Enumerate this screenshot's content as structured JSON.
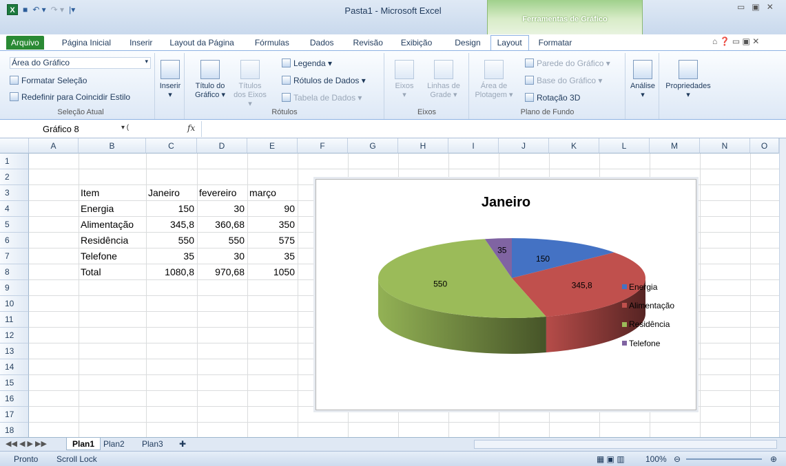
{
  "window": {
    "title": "Pasta1 - Microsoft Excel",
    "context_title": "Ferramentas de Gráfico"
  },
  "tabs": [
    "Arquivo",
    "Página Inicial",
    "Inserir",
    "Layout da Página",
    "Fórmulas",
    "Dados",
    "Revisão",
    "Exibição",
    "Design",
    "Layout",
    "Formatar"
  ],
  "active_tab": "Layout",
  "ribbon": {
    "selecao": {
      "dropdown": "Área do Gráfico",
      "format": "Formatar Seleção",
      "reset": "Redefinir para Coincidir Estilo",
      "label": "Seleção Atual"
    },
    "inserir": {
      "label": "Inserir"
    },
    "rotulos": {
      "titulo1": "Título do",
      "titulo2": "Gráfico ▾",
      "eixos1": "Títulos",
      "eixos2": "dos Eixos ▾",
      "legenda": "Legenda ▾",
      "rotulos_dados": "Rótulos de Dados ▾",
      "tabela": "Tabela de Dados ▾",
      "label": "Rótulos"
    },
    "eixos": {
      "eixos": "Eixos",
      "linhas1": "Linhas de",
      "linhas2": "Grade ▾",
      "label": "Eixos"
    },
    "plano": {
      "area1": "Área de",
      "area2": "Plotagem ▾",
      "parede": "Parede do Gráfico ▾",
      "base": "Base do Gráfico ▾",
      "rotacao": "Rotação 3D",
      "label": "Plano de Fundo"
    },
    "analise": "Análise",
    "propriedades": "Propriedades"
  },
  "name_box": "Gráfico 8",
  "fx": "fx",
  "columns": [
    "A",
    "B",
    "C",
    "D",
    "E",
    "F",
    "G",
    "H",
    "I",
    "J",
    "K",
    "L",
    "M",
    "N",
    "O"
  ],
  "rows": [
    "1",
    "2",
    "3",
    "4",
    "5",
    "6",
    "7",
    "8",
    "9",
    "10",
    "11",
    "12",
    "13",
    "14",
    "15",
    "16",
    "17",
    "18"
  ],
  "table": {
    "header": [
      "Item",
      "Janeiro",
      "fevereiro",
      "março"
    ],
    "rows": [
      [
        "Energia",
        "150",
        "30",
        "90"
      ],
      [
        "Alimentação",
        "345,8",
        "360,68",
        "350"
      ],
      [
        "Residência",
        "550",
        "550",
        "575"
      ],
      [
        "Telefone",
        "35",
        "30",
        "35"
      ],
      [
        "Total",
        "1080,8",
        "970,68",
        "1050"
      ]
    ]
  },
  "chart_data": {
    "type": "pie",
    "title": "Janeiro",
    "categories": [
      "Energia",
      "Alimentação",
      "Residência",
      "Telefone"
    ],
    "values": [
      150,
      345.8,
      550,
      35
    ],
    "data_labels": [
      "150",
      "345,8",
      "550",
      "35"
    ],
    "colors": [
      "#4472c4",
      "#c0504d",
      "#9bbb59",
      "#8064a2"
    ],
    "legend": "right"
  },
  "sheets": [
    "Plan1",
    "Plan2",
    "Plan3"
  ],
  "status": {
    "left": "Pronto",
    "scroll": "Scroll Lock",
    "zoom": "100%"
  }
}
